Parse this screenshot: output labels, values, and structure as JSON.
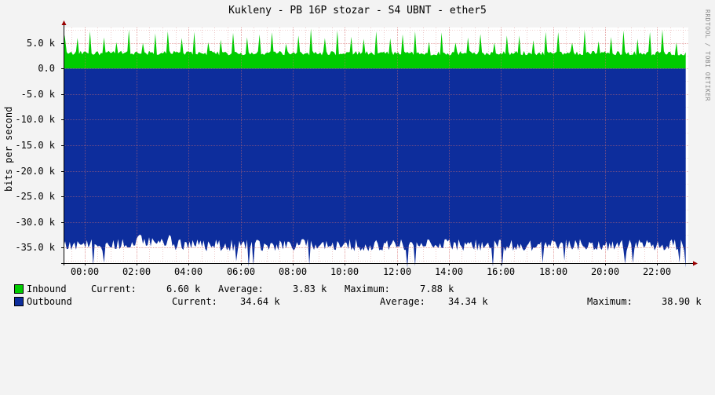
{
  "title": "Kukleny - PB 16P stozar - S4 UBNT - ether5",
  "watermark": "RRDTOOL / TOBI OETIKER",
  "colors": {
    "background": "#f3f3f3",
    "plot_background": "#ffffff",
    "grid": "#e3a8a8",
    "inbound": "#00cc00",
    "outbound": "#0d2d9c",
    "axis": "#000000",
    "arrow": "#990000"
  },
  "legend": {
    "inbound": {
      "label": "Inbound",
      "current_label": "Current:",
      "current_value": "6.60 k",
      "average_label": "Average:",
      "average_value": "3.83 k",
      "maximum_label": "Maximum:",
      "maximum_value": "7.88 k"
    },
    "outbound": {
      "label": "Outbound",
      "current_label": "Current:",
      "current_value": "34.64 k",
      "average_label": "Average:",
      "average_value": "34.34 k",
      "maximum_label": "Maximum:",
      "maximum_value": "38.90 k"
    }
  },
  "chart_data": {
    "type": "area",
    "title": "Kukleny - PB 16P stozar - S4 UBNT - ether5",
    "xlabel": "",
    "ylabel": "bits per second",
    "y_ticks": [
      "5.0 k",
      "0.0",
      "-5.0 k",
      "-10.0 k",
      "-15.0 k",
      "-20.0 k",
      "-25.0 k",
      "-30.0 k",
      "-35.0 k"
    ],
    "y_tick_values": [
      5000,
      0,
      -5000,
      -10000,
      -15000,
      -20000,
      -25000,
      -30000,
      -35000
    ],
    "x_ticks": [
      "00:00",
      "02:00",
      "04:00",
      "06:00",
      "08:00",
      "10:00",
      "12:00",
      "14:00",
      "16:00",
      "18:00",
      "20:00",
      "22:00"
    ],
    "x_tick_hours": [
      0,
      2,
      4,
      6,
      8,
      10,
      12,
      14,
      16,
      18,
      20,
      22
    ],
    "x_range_hours": [
      -0.8,
      23.2
    ],
    "ylim": [
      -38000,
      8000
    ],
    "grid": true,
    "legend_position": "bottom",
    "series": [
      {
        "name": "Inbound",
        "color": "#00cc00",
        "sign": 1,
        "approx_stats": {
          "baseline": 3000,
          "spike_peak": 7880,
          "spike_interval_hours": 0.5,
          "average": 3830
        }
      },
      {
        "name": "Outbound",
        "color": "#0d2d9c",
        "sign": -1,
        "approx_stats": {
          "baseline": 34500,
          "range": [
            32000,
            38900
          ],
          "average": 34340
        }
      }
    ]
  }
}
